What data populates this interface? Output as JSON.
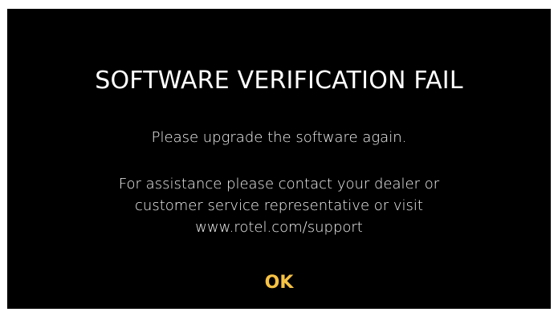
{
  "dialog": {
    "title": "SOFTWARE VERIFICATION FAIL",
    "message": "Please upgrade the software again.",
    "assistance_lines": [
      "For  assistance please contact your dealer or",
      "customer service representative or visit",
      "www.rotel.com/support"
    ],
    "ok_label": "OK"
  },
  "colors": {
    "background": "#000000",
    "text": "#ffffff",
    "accent": "#f7c244"
  }
}
